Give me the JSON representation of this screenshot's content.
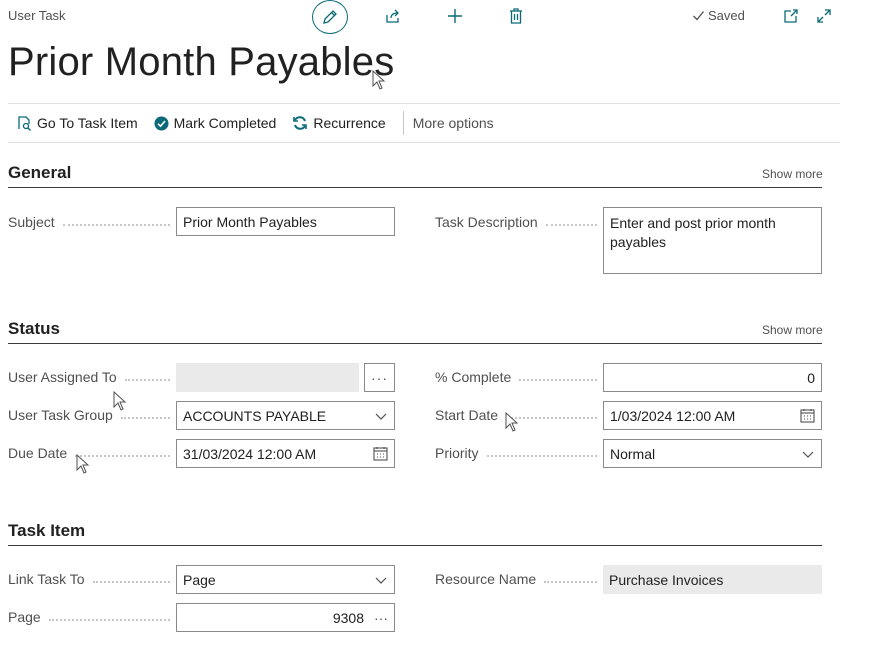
{
  "header": {
    "caption": "User Task",
    "title": "Prior Month Payables",
    "saved": "Saved"
  },
  "actions": {
    "go_to_task_item": "Go To Task Item",
    "mark_completed": "Mark Completed",
    "recurrence": "Recurrence",
    "more_options": "More options"
  },
  "general": {
    "title": "General",
    "show_more": "Show more",
    "subject_label": "Subject",
    "subject_value": "Prior Month Payables",
    "task_description_label": "Task Description",
    "task_description_value": "Enter and post prior month payables"
  },
  "status": {
    "title": "Status",
    "show_more": "Show more",
    "user_assigned_to_label": "User Assigned To",
    "user_assigned_to_value": "",
    "user_task_group_label": "User Task Group",
    "user_task_group_value": "ACCOUNTS PAYABLE",
    "due_date_label": "Due Date",
    "due_date_value": "31/03/2024 12:00 AM",
    "percent_complete_label": "% Complete",
    "percent_complete_value": "0",
    "start_date_label": "Start Date",
    "start_date_value": "1/03/2024 12:00 AM",
    "priority_label": "Priority",
    "priority_value": "Normal"
  },
  "task_item": {
    "title": "Task Item",
    "link_task_to_label": "Link Task To",
    "link_task_to_value": "Page",
    "page_label": "Page",
    "page_value": "9308",
    "resource_name_label": "Resource Name",
    "resource_name_value": "Purchase Invoices"
  },
  "icons": {
    "edit": "pencil-icon",
    "share": "share-icon",
    "new": "plus-icon",
    "delete": "trash-icon",
    "open_new_window": "open-new-window-icon",
    "expand": "expand-icon",
    "saved": "checkmark-icon",
    "dropdown": "chevron-down-icon",
    "calendar": "calendar-icon",
    "lookup": "ellipsis-icon"
  },
  "colors": {
    "accent": "#0b6a79"
  }
}
